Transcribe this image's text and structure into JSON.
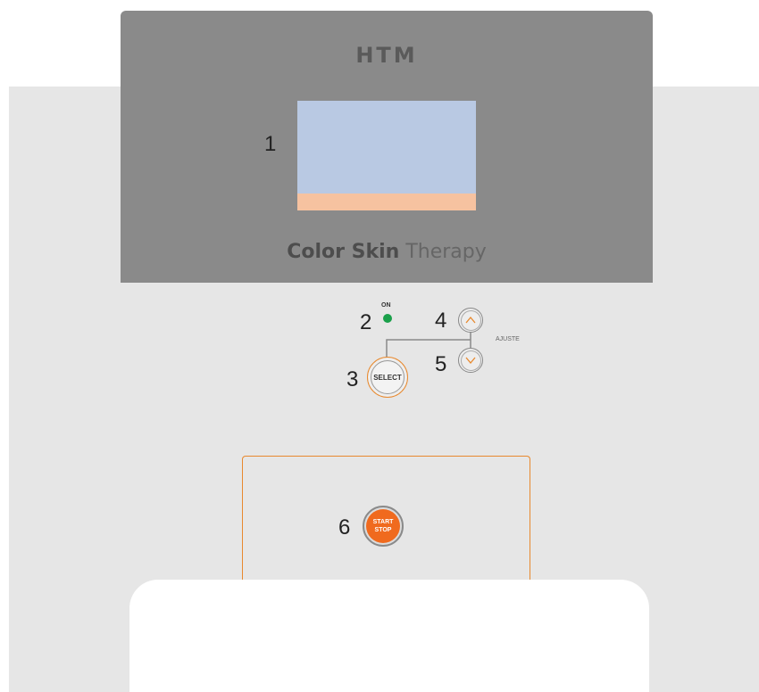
{
  "brand": "HTM",
  "product": {
    "bold": "Color Skin",
    "light": "Therapy"
  },
  "callouts": {
    "display": "1",
    "led": "2",
    "select": "3",
    "up": "4",
    "down": "5",
    "start": "6"
  },
  "led": {
    "label": "ON",
    "color": "#1aa04a"
  },
  "buttons": {
    "select_label": "SELECT",
    "adjust_label": "AJUSTE",
    "start_line1": "START",
    "start_line2": "STOP"
  },
  "colors": {
    "accent": "#e8892e",
    "start_button": "#f06a1e",
    "display": "#b9c9e3",
    "display_bar": "#f6c2a0",
    "panel": "#8a8a8a"
  }
}
